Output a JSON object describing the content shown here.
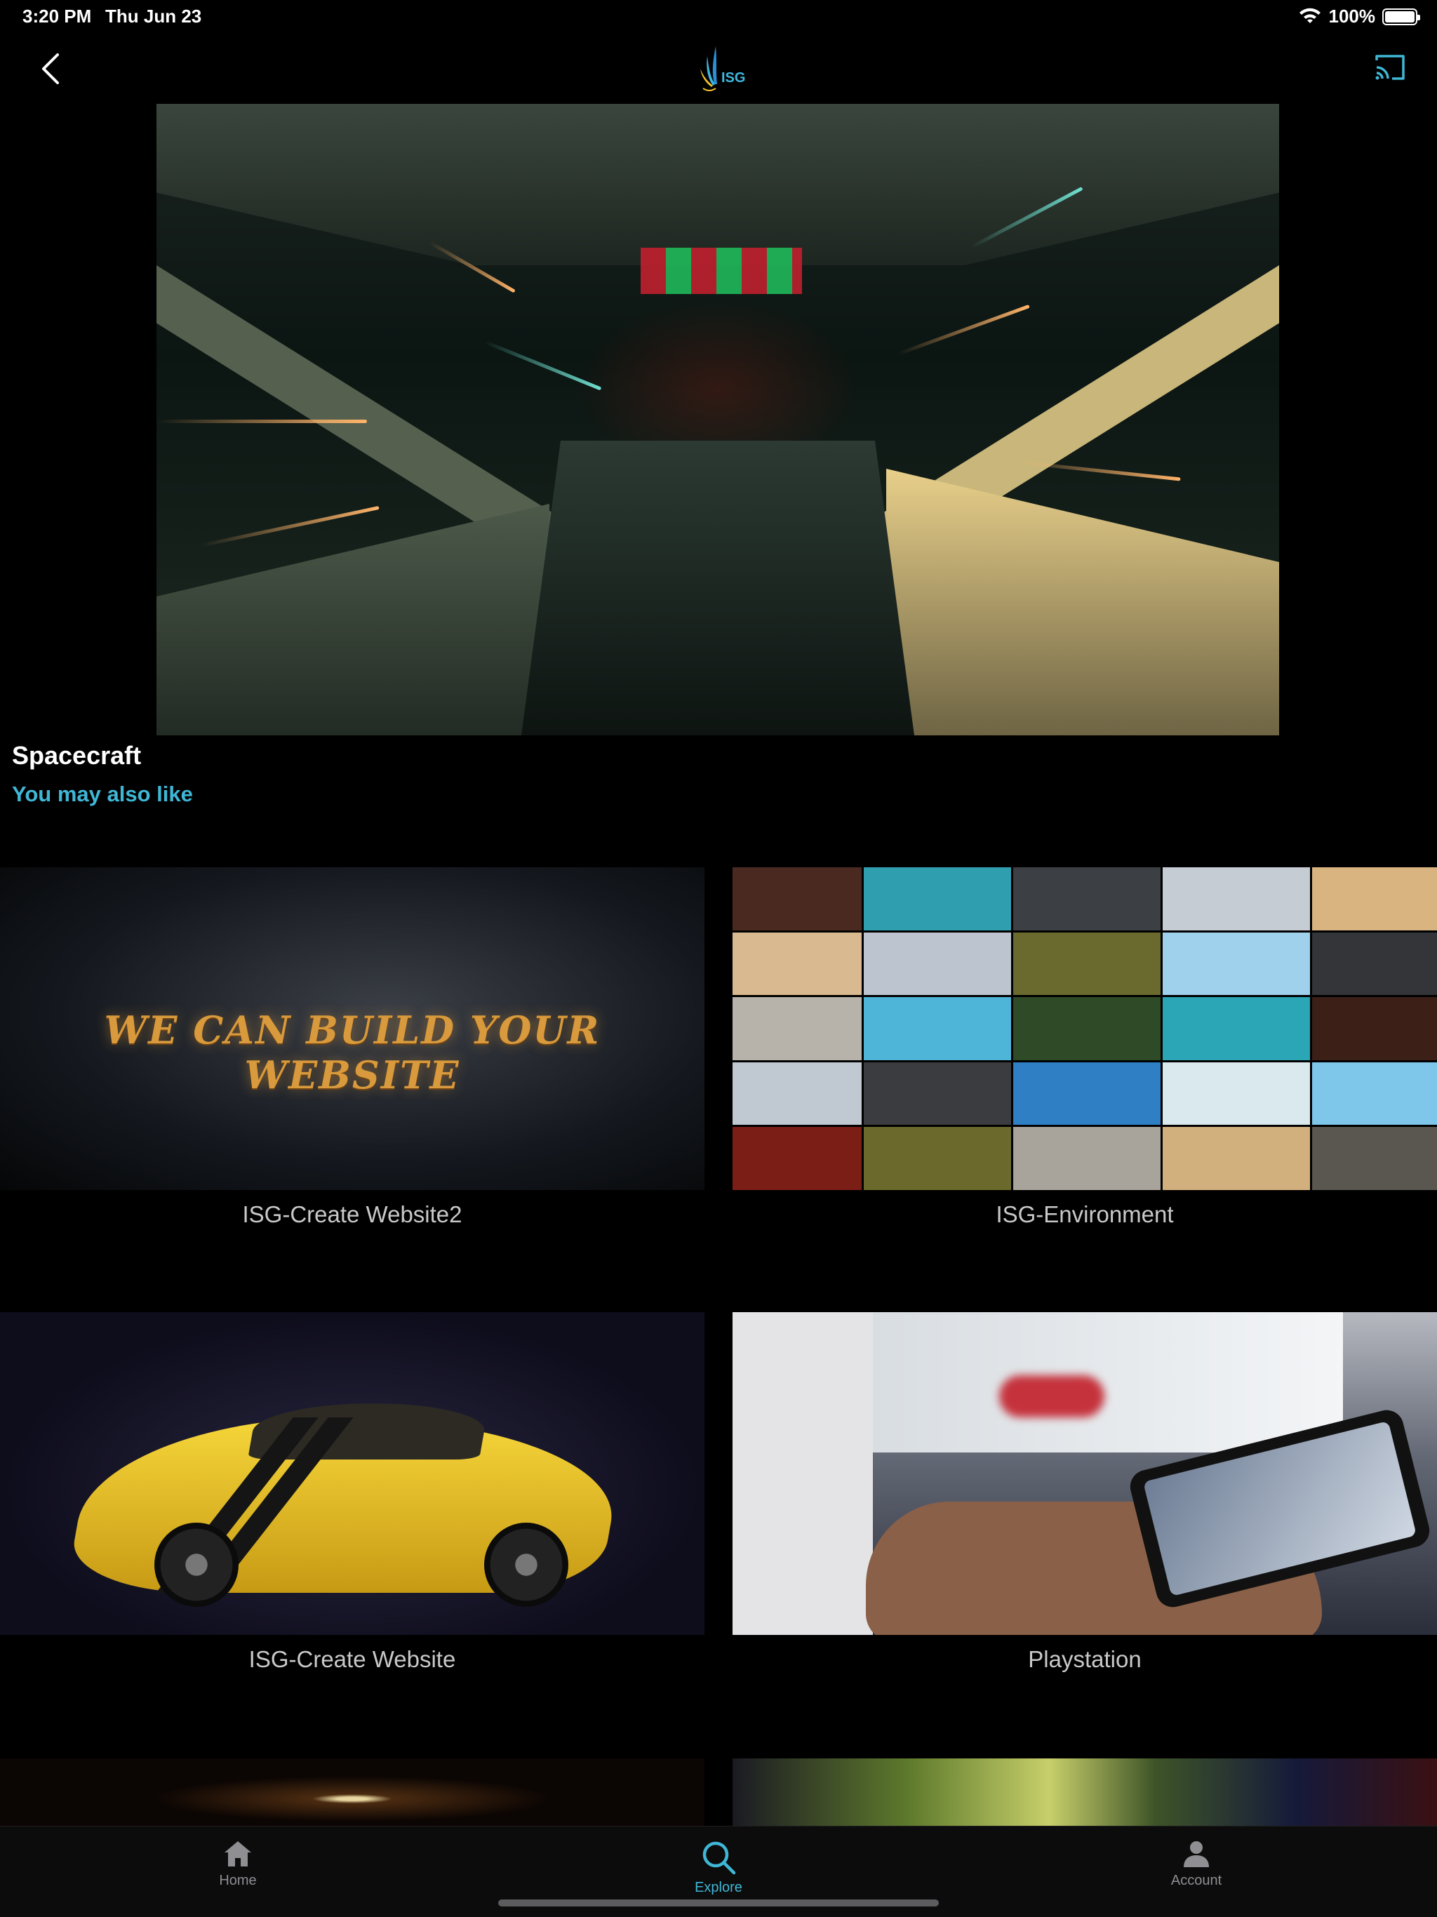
{
  "status_bar": {
    "time": "3:20 PM",
    "date": "Thu Jun 23",
    "battery": "100%"
  },
  "nav": {
    "logo_text": "ISG",
    "accent_color": "#3fb7d6"
  },
  "video": {
    "title": "Spacecraft",
    "related_heading": "You may also like"
  },
  "related": [
    {
      "label": "ISG-Create Website2",
      "overlay_text": "WE CAN BUILD YOUR WEBSITE"
    },
    {
      "label": "ISG-Environment"
    },
    {
      "label": "ISG-Create Website"
    },
    {
      "label": "Playstation"
    }
  ],
  "tab_bar": {
    "items": [
      {
        "label": "Home",
        "icon": "house-icon",
        "active": false
      },
      {
        "label": "Explore",
        "icon": "search-icon",
        "active": true
      },
      {
        "label": "Account",
        "icon": "person-icon",
        "active": false
      }
    ]
  }
}
